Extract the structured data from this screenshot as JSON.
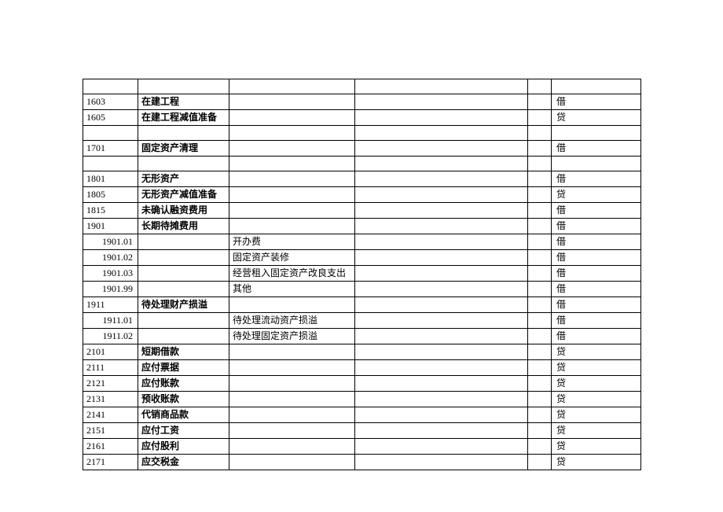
{
  "rows": [
    {
      "c1": "",
      "c2": "",
      "c3": "",
      "c6": "",
      "c1class": "",
      "c2class": ""
    },
    {
      "c1": "1603",
      "c2": "在建工程",
      "c3": "",
      "c6": "借",
      "c1class": "code-main",
      "c2class": "bold"
    },
    {
      "c1": "1605",
      "c2": "在建工程减值准备",
      "c3": "",
      "c6": "贷",
      "c1class": "code-main",
      "c2class": "bold"
    },
    {
      "c1": "",
      "c2": "",
      "c3": "",
      "c6": "",
      "c1class": "",
      "c2class": ""
    },
    {
      "c1": "1701",
      "c2": "固定资产清理",
      "c3": "",
      "c6": "借",
      "c1class": "code-main",
      "c2class": "bold"
    },
    {
      "c1": "",
      "c2": "",
      "c3": "",
      "c6": "",
      "c1class": "",
      "c2class": ""
    },
    {
      "c1": "1801",
      "c2": "无形资产",
      "c3": "",
      "c6": "借",
      "c1class": "code-main",
      "c2class": "bold"
    },
    {
      "c1": "1805",
      "c2": "无形资产减值准备",
      "c3": "",
      "c6": "贷",
      "c1class": "code-main",
      "c2class": "bold"
    },
    {
      "c1": "1815",
      "c2": "未确认融资费用",
      "c3": "",
      "c6": "借",
      "c1class": "code-main",
      "c2class": "bold"
    },
    {
      "c1": "1901",
      "c2": "长期待摊费用",
      "c3": "",
      "c6": "借",
      "c1class": "code-main",
      "c2class": "bold"
    },
    {
      "c1": "1901.01",
      "c2": "",
      "c3": "开办费",
      "c6": "借",
      "c1class": "code-sub",
      "c2class": ""
    },
    {
      "c1": "1901.02",
      "c2": "",
      "c3": "固定资产装修",
      "c6": "借",
      "c1class": "code-sub",
      "c2class": ""
    },
    {
      "c1": "1901.03",
      "c2": "",
      "c3": "经营租入固定资产改良支出",
      "c6": "借",
      "c1class": "code-sub",
      "c2class": ""
    },
    {
      "c1": "1901.99",
      "c2": "",
      "c3": "其他",
      "c6": "借",
      "c1class": "code-sub",
      "c2class": ""
    },
    {
      "c1": "1911",
      "c2": "待处理财产损溢",
      "c3": "",
      "c6": "借",
      "c1class": "code-main",
      "c2class": "bold"
    },
    {
      "c1": "1911.01",
      "c2": "",
      "c3": "待处理流动资产损溢",
      "c6": "借",
      "c1class": "code-sub",
      "c2class": ""
    },
    {
      "c1": "1911.02",
      "c2": "",
      "c3": "待处理固定资产损溢",
      "c6": "借",
      "c1class": "code-sub",
      "c2class": ""
    },
    {
      "c1": "2101",
      "c2": "短期借款",
      "c3": "",
      "c6": "贷",
      "c1class": "code-main",
      "c2class": "bold"
    },
    {
      "c1": "2111",
      "c2": "应付票据",
      "c3": "",
      "c6": "贷",
      "c1class": "code-main",
      "c2class": "bold"
    },
    {
      "c1": "2121",
      "c2": "应付账款",
      "c3": "",
      "c6": "贷",
      "c1class": "code-main",
      "c2class": "bold"
    },
    {
      "c1": "2131",
      "c2": "预收账款",
      "c3": "",
      "c6": "贷",
      "c1class": "code-main",
      "c2class": "bold"
    },
    {
      "c1": "2141",
      "c2": "代销商品款",
      "c3": "",
      "c6": "贷",
      "c1class": "code-main",
      "c2class": "bold"
    },
    {
      "c1": "2151",
      "c2": "应付工资",
      "c3": "",
      "c6": "贷",
      "c1class": "code-main",
      "c2class": "bold"
    },
    {
      "c1": "2161",
      "c2": "应付股利",
      "c3": "",
      "c6": "贷",
      "c1class": "code-main",
      "c2class": "bold"
    },
    {
      "c1": "2171",
      "c2": "应交税金",
      "c3": "",
      "c6": "贷",
      "c1class": "code-main",
      "c2class": "bold"
    }
  ]
}
